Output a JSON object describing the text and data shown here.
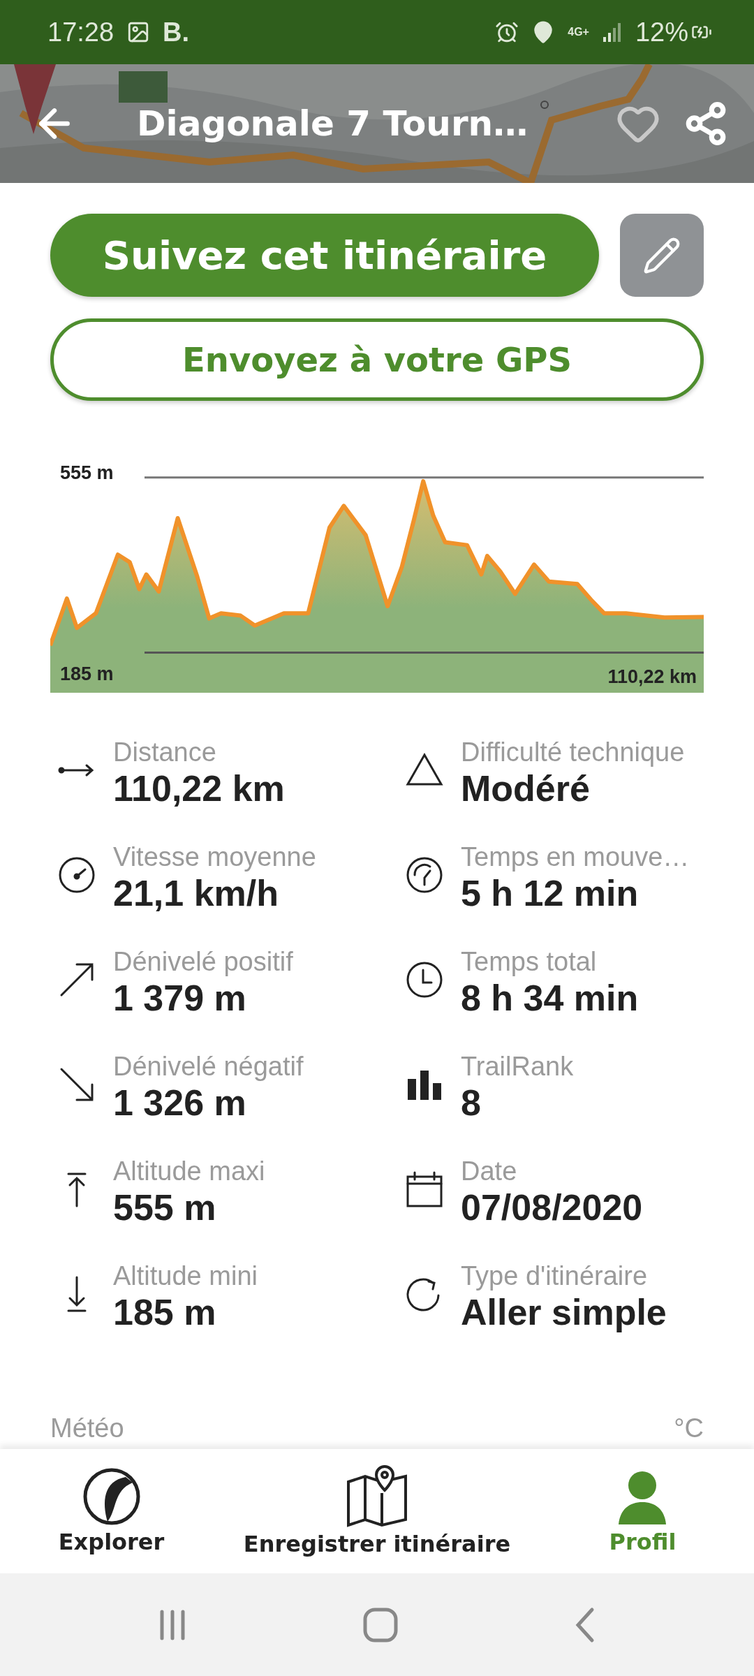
{
  "status_bar": {
    "time": "17:28",
    "carrier": "B.",
    "network": "4G+",
    "battery": "12%"
  },
  "header": {
    "title": "Diagonale 7 Tourn…"
  },
  "actions": {
    "follow": "Suivez cet itinéraire",
    "send": "Envoyez à votre GPS"
  },
  "profile": {
    "max_label": "555 m",
    "min_label": "185 m",
    "distance_label": "110,22 km"
  },
  "stats": [
    {
      "kind": "distance",
      "label": "Distance",
      "value": "110,22 km"
    },
    {
      "kind": "difficulty",
      "label": "Difficulté technique",
      "value": "Modéré"
    },
    {
      "kind": "speed",
      "label": "Vitesse moyenne",
      "value": "21,1 km/h"
    },
    {
      "kind": "moving",
      "label": "Temps en mouve…",
      "value": "5 h 12 min"
    },
    {
      "kind": "ascent",
      "label": "Dénivelé positif",
      "value": "1 379 m"
    },
    {
      "kind": "clock",
      "label": "Temps total",
      "value": "8 h 34 min"
    },
    {
      "kind": "descent",
      "label": "Dénivelé négatif",
      "value": "1 326 m"
    },
    {
      "kind": "rank",
      "label": "TrailRank",
      "value": "8"
    },
    {
      "kind": "max",
      "label": "Altitude maxi",
      "value": "555 m"
    },
    {
      "kind": "date",
      "label": "Date",
      "value": "07/08/2020"
    },
    {
      "kind": "min",
      "label": "Altitude mini",
      "value": "185 m"
    },
    {
      "kind": "loop",
      "label": "Type d'itinéraire",
      "value": "Aller simple"
    }
  ],
  "weather": {
    "label": "Météo",
    "unit": "°C"
  },
  "nav": [
    {
      "kind": "explore",
      "label": "Explorer",
      "selected": false
    },
    {
      "kind": "record",
      "label": "Enregistrer itinéraire",
      "selected": false
    },
    {
      "kind": "profile",
      "label": "Profil",
      "selected": true
    }
  ]
}
